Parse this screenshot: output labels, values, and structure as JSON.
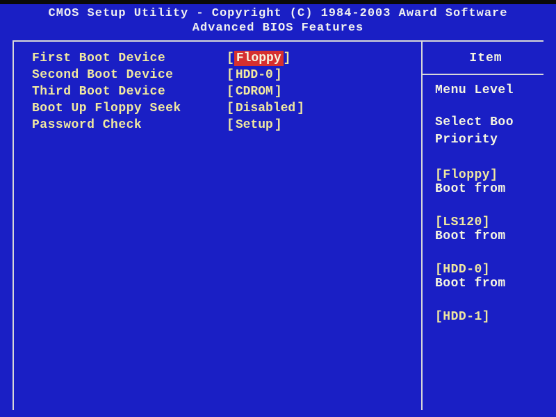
{
  "header": {
    "line1": "CMOS Setup Utility - Copyright (C) 1984-2003 Award Software",
    "line2": "Advanced BIOS Features"
  },
  "settings": [
    {
      "label": "First Boot Device",
      "value": "Floppy",
      "highlighted": true
    },
    {
      "label": "Second Boot Device",
      "value": "HDD-0",
      "highlighted": false
    },
    {
      "label": "Third Boot Device",
      "value": "CDROM",
      "highlighted": false
    },
    {
      "label": "Boot Up Floppy Seek",
      "value": "Disabled",
      "highlighted": false
    },
    {
      "label": "Password Check",
      "value": "Setup",
      "highlighted": false
    }
  ],
  "right": {
    "title": "Item",
    "menu_level_label": "Menu Level",
    "help_line1": "Select Boo",
    "help_line2": "Priority",
    "options": [
      {
        "name": "[Floppy]",
        "desc": "Boot from"
      },
      {
        "name": "[LS120]",
        "desc": "Boot from"
      },
      {
        "name": "[HDD-0]",
        "desc": "Boot from"
      },
      {
        "name": "[HDD-1]",
        "desc": ""
      }
    ]
  }
}
